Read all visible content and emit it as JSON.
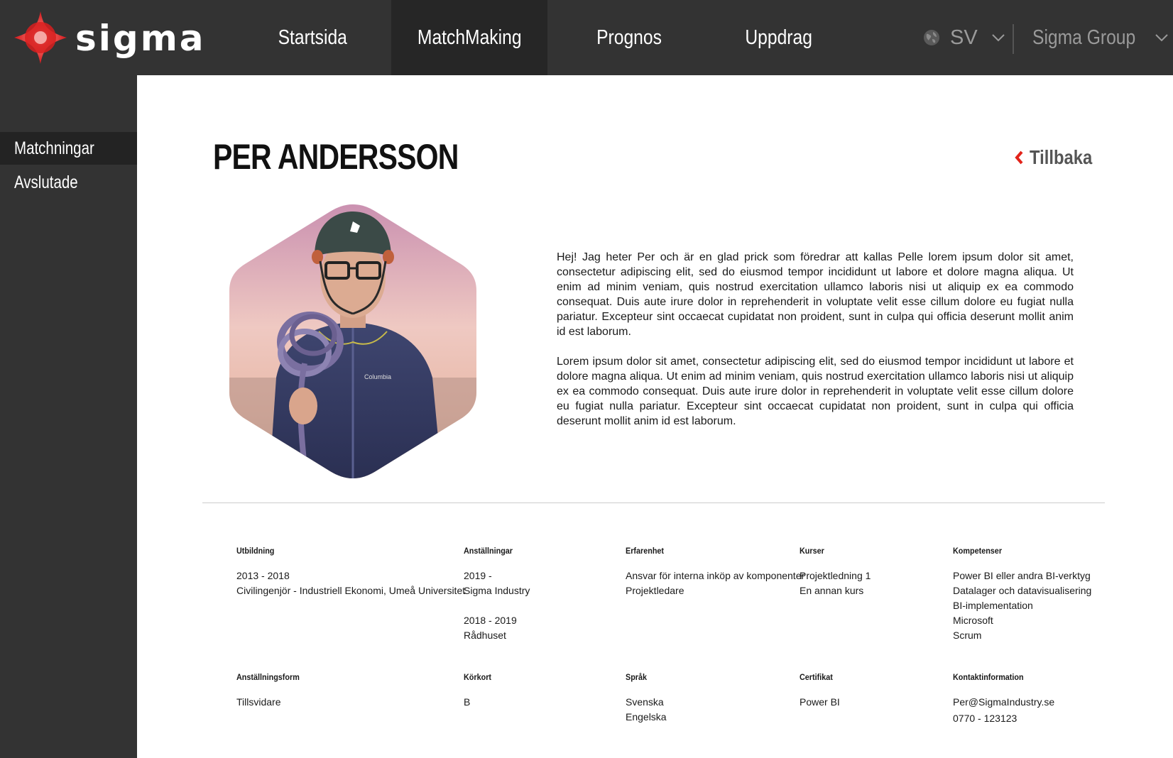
{
  "brand": {
    "name": "sigma",
    "accent": "#e2231a"
  },
  "nav": {
    "items": [
      {
        "label": "Startsida"
      },
      {
        "label": "MatchMaking"
      },
      {
        "label": "Prognos"
      },
      {
        "label": "Uppdrag"
      }
    ],
    "active": "MatchMaking",
    "language": "SV",
    "company": "Sigma Group"
  },
  "sidebar": {
    "items": [
      {
        "label": "Matchningar"
      },
      {
        "label": "Avslutade"
      }
    ],
    "active": "Matchningar"
  },
  "profile": {
    "name": "PER ANDERSSON",
    "back_label": "Tillbaka",
    "bio": [
      "Hej! Jag heter Per och är en glad prick som föredrar att kallas Pelle lorem ipsum dolor sit amet, consectetur adipiscing elit, sed do eiusmod tempor incididunt ut labore et dolore magna aliqua. Ut enim ad minim veniam, quis nostrud exercitation ullamco laboris nisi ut aliquip ex ea commodo consequat. Duis aute irure dolor in reprehenderit in voluptate velit esse cillum dolore eu fugiat nulla pariatur. Excepteur sint occaecat cupidatat non proident, sunt in culpa qui officia deserunt mollit anim id est laborum.",
      "Lorem ipsum dolor sit amet, consectetur adipiscing elit, sed do eiusmod tempor incididunt ut labore et dolore magna aliqua. Ut enim ad minim veniam, quis nostrud exercitation ullamco laboris nisi ut aliquip ex ea commodo consequat. Duis aute irure dolor in reprehenderit in voluptate velit esse cillum dolore eu fugiat nulla pariatur. Excepteur sint occaecat cupidatat non proident, sunt in culpa qui officia deserunt mollit anim id est laborum."
    ],
    "photo_text": "Columbia"
  },
  "details": {
    "utbildning": {
      "label": "Utbildning",
      "lines": [
        "2013 - 2018",
        "Civilingenjör - Industriell Ekonomi, Umeå Universitet"
      ]
    },
    "anstallningar": {
      "label": "Anställningar",
      "lines": [
        "2019 -",
        "Sigma Industry",
        "",
        "2018 - 2019",
        "Rådhuset"
      ]
    },
    "erfarenhet": {
      "label": "Erfarenhet",
      "lines": [
        "Ansvar för interna inköp av komponenter",
        "Projektledare"
      ]
    },
    "kurser": {
      "label": "Kurser",
      "lines": [
        "Projektledning 1",
        "En annan kurs"
      ]
    },
    "kompetenser": {
      "label": "Kompetenser",
      "lines": [
        "Power BI eller andra BI-verktyg",
        "Datalager och datavisualisering",
        "BI-implementation",
        "Microsoft",
        "Scrum"
      ]
    },
    "anstallningsform": {
      "label": "Anställningsform",
      "lines": [
        "Tillsvidare"
      ]
    },
    "korkort": {
      "label": "Körkort",
      "lines": [
        "B"
      ]
    },
    "sprak": {
      "label": "Språk",
      "lines": [
        "Svenska",
        "Engelska"
      ]
    },
    "certifikat": {
      "label": "Certifikat",
      "lines": [
        "Power BI"
      ]
    },
    "kontakt": {
      "label": "Kontaktinformation",
      "lines": [
        "Per@SigmaIndustry.se",
        "0770 - 123123"
      ]
    }
  }
}
